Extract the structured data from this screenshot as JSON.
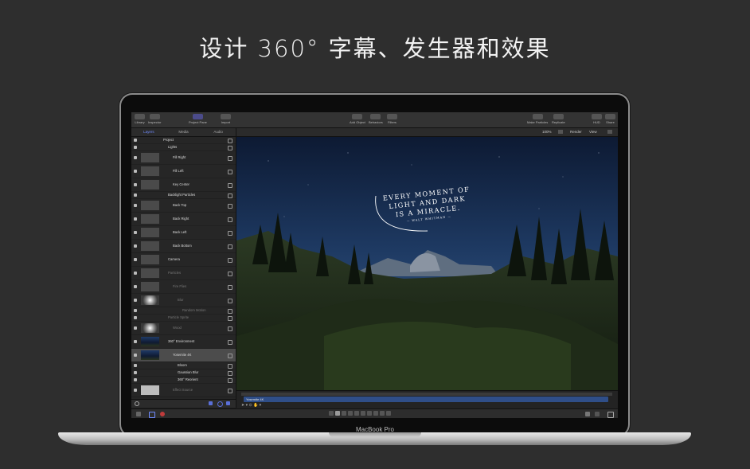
{
  "headline": "设计 360° 字幕、发生器和效果",
  "device_label": "MacBook Pro",
  "toolbar": {
    "library": "Library",
    "inspector": "Inspector",
    "project_pane": "Project Pane",
    "import": "Import",
    "add_object": "Add Object",
    "behaviors": "Behaviors",
    "filters": "Filters",
    "make_particles": "Make Particles",
    "replicate": "Replicate",
    "hud": "HUD",
    "share": "Share"
  },
  "left_panel": {
    "tabs": [
      "Layers",
      "Media",
      "Audio"
    ],
    "active_tab": "Layers",
    "layers": [
      {
        "label": "Project",
        "indent": 0,
        "thumb": "none",
        "size": "small",
        "dim": false
      },
      {
        "label": "Lights",
        "indent": 1,
        "thumb": "none",
        "size": "small",
        "dim": false
      },
      {
        "label": "Fill Right",
        "indent": 2,
        "thumb": "gray",
        "size": "big",
        "dim": false
      },
      {
        "label": "Fill Left",
        "indent": 2,
        "thumb": "gray",
        "size": "big",
        "dim": false
      },
      {
        "label": "Key Center",
        "indent": 2,
        "thumb": "gray",
        "size": "big",
        "dim": false
      },
      {
        "label": "Backlight Particles",
        "indent": 1,
        "thumb": "none",
        "size": "small",
        "dim": false
      },
      {
        "label": "Back Top",
        "indent": 2,
        "thumb": "gray",
        "size": "big",
        "dim": false
      },
      {
        "label": "Back Right",
        "indent": 2,
        "thumb": "gray",
        "size": "big",
        "dim": false
      },
      {
        "label": "Back Left",
        "indent": 2,
        "thumb": "gray",
        "size": "big",
        "dim": false
      },
      {
        "label": "Back Bottom",
        "indent": 2,
        "thumb": "gray",
        "size": "big",
        "dim": false
      },
      {
        "label": "Camera",
        "indent": 1,
        "thumb": "gray",
        "size": "big",
        "dim": false
      },
      {
        "label": "Particles",
        "indent": 1,
        "thumb": "gray",
        "size": "big",
        "dim": true
      },
      {
        "label": "Fire Flies",
        "indent": 2,
        "thumb": "gray",
        "size": "big",
        "dim": true
      },
      {
        "label": "Blur",
        "indent": 3,
        "thumb": "glow",
        "size": "big",
        "dim": true
      },
      {
        "label": "Random Motion",
        "indent": 4,
        "thumb": "none",
        "size": "small",
        "dim": true
      },
      {
        "label": "Particle Sprite",
        "indent": 1,
        "thumb": "none",
        "size": "small",
        "dim": true
      },
      {
        "label": "Wood",
        "indent": 2,
        "thumb": "glow",
        "size": "big",
        "dim": true
      },
      {
        "label": "360° Environment",
        "indent": 1,
        "thumb": "sky",
        "size": "big",
        "dim": false
      },
      {
        "label": "Yosemite 4K",
        "indent": 2,
        "thumb": "sky",
        "size": "big",
        "dim": false,
        "selected": true
      },
      {
        "label": "Bloom",
        "indent": 3,
        "thumb": "none",
        "size": "small",
        "dim": false
      },
      {
        "label": "Gaussian Blur",
        "indent": 3,
        "thumb": "none",
        "size": "small",
        "dim": false
      },
      {
        "label": "360° Reorient",
        "indent": 3,
        "thumb": "none",
        "size": "small",
        "dim": false
      },
      {
        "label": "Effect Source",
        "indent": 2,
        "thumb": "white",
        "size": "big",
        "dim": true
      }
    ]
  },
  "canvas_header": {
    "zoom": "100%",
    "render": "Render",
    "view": "View"
  },
  "canvas_quote": {
    "line1": "EVERY MOMENT OF",
    "line2": "LIGHT AND DARK",
    "line3": "IS A MIRACLE.",
    "author": "— WALT WHITMAN —"
  },
  "timeline": {
    "clip_label": "Yosemite 4K"
  }
}
